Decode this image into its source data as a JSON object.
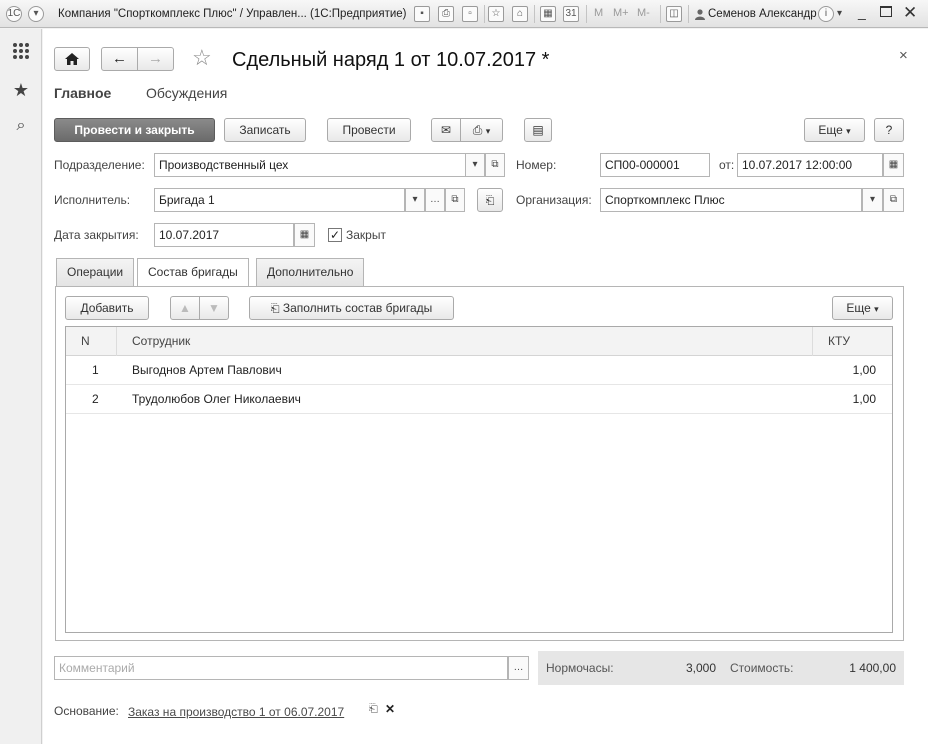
{
  "window": {
    "title": "Компания \"Спорткомплекс Плюс\" / Управлен... (1С:Предприятие)",
    "user": "Семенов Александр",
    "m_labels": [
      "M",
      "M+",
      "M-"
    ]
  },
  "document": {
    "title": "Сдельный наряд 1 от 10.07.2017 *",
    "section_tabs": [
      "Главное",
      "Обсуждения"
    ]
  },
  "toolbar": {
    "post_and_close": "Провести и закрыть",
    "save": "Записать",
    "post": "Провести",
    "more": "Еще",
    "help": "?"
  },
  "form": {
    "department_label": "Подразделение:",
    "department_value": "Производственный цех",
    "number_label": "Номер:",
    "number_value": "СП00-000001",
    "date_label": "от:",
    "date_value": "10.07.2017 12:00:00",
    "executor_label": "Исполнитель:",
    "executor_value": "Бригада 1",
    "organization_label": "Организация:",
    "organization_value": "Спорткомплекс Плюс",
    "close_date_label": "Дата закрытия:",
    "close_date_value": "10.07.2017",
    "closed_label": "Закрыт",
    "closed_checked": true
  },
  "tabs": [
    {
      "label": "Операции",
      "active": false
    },
    {
      "label": "Состав бригады",
      "active": true
    },
    {
      "label": "Дополнительно",
      "active": false
    }
  ],
  "tab_toolbar": {
    "add": "Добавить",
    "fill": "Заполнить состав бригады",
    "more": "Еще"
  },
  "table": {
    "columns": [
      "N",
      "Сотрудник",
      "КТУ"
    ],
    "rows": [
      {
        "n": "1",
        "employee": "Выгоднов Артем Павлович",
        "ktu": "1,00"
      },
      {
        "n": "2",
        "employee": "Трудолюбов Олег Николаевич",
        "ktu": "1,00"
      }
    ]
  },
  "footer": {
    "comment_placeholder": "Комментарий",
    "hours_label": "Нормочасы:",
    "hours_value": "3,000",
    "cost_label": "Стоимость:",
    "cost_value": "1 400,00",
    "basis_label": "Основание:",
    "basis_link": "Заказ на производство 1 от 06.07.2017"
  }
}
